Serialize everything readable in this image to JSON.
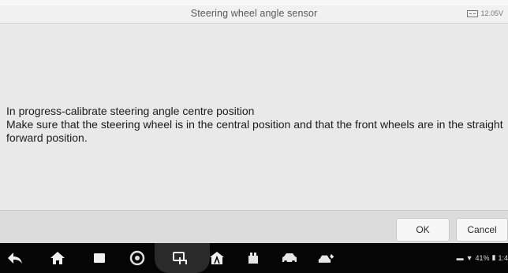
{
  "window": {
    "title": "Steering wheel angle sensor",
    "battery_voltage": "12.05V"
  },
  "message": {
    "line1": "In progress-calibrate steering angle centre position",
    "line2": "Make sure that the steering wheel is in the central position and that the front wheels are in the straight forward position."
  },
  "buttons": {
    "ok_label": "OK",
    "cancel_label": "Cancel"
  },
  "navbar": {
    "icons": [
      "back-icon",
      "home-icon",
      "recent-apps-icon",
      "browser-icon",
      "vci-connect-icon",
      "autel-home-icon",
      "service-icon",
      "car-icon",
      "diagnostics-icon"
    ],
    "status": {
      "battery_percent": "41%",
      "time": "1:4"
    }
  }
}
